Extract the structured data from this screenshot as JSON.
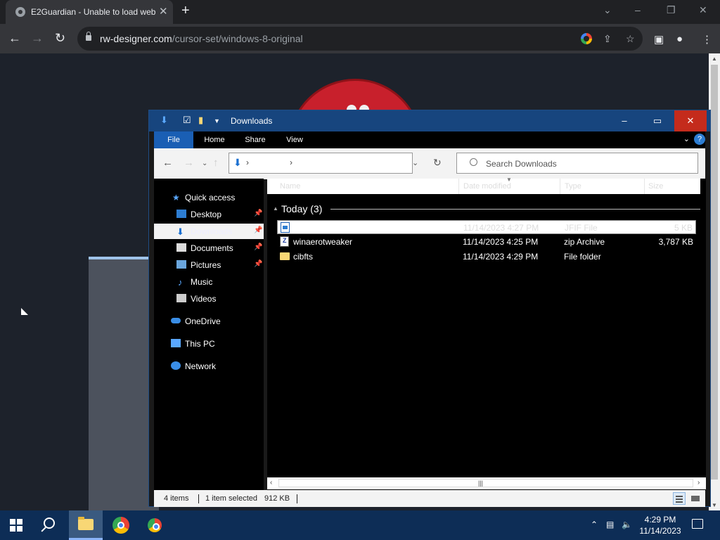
{
  "browser": {
    "tab_title": "E2Guardian - Unable to load web",
    "tab_close": "✕",
    "new_tab": "+",
    "url_host": "rw-designer.com",
    "url_path": "/cursor-set/windows-8-original"
  },
  "explorer": {
    "title": "Downloads",
    "minimize": "–",
    "maximize": "▭",
    "close": "✕",
    "ribbon_tabs": [
      "File",
      "Home",
      "Share",
      "View"
    ],
    "help": "?",
    "address_sep_1": "›",
    "address_sep_2": "›",
    "search_placeholder": "Search Downloads",
    "nav": {
      "quick_access": "Quick access",
      "desktop": "Desktop",
      "downloads": "Downloads",
      "documents": "Documents",
      "pictures": "Pictures",
      "music": "Music",
      "videos": "Videos",
      "onedrive": "OneDrive",
      "this_pc": "This PC",
      "network": "Network"
    },
    "columns": [
      "Name",
      "Date modified",
      "Type",
      "Size"
    ],
    "group": "Today (3)",
    "files": [
      {
        "name": "",
        "date": "11/14/2023 4:27 PM",
        "type": "JFIF File",
        "size": "5 KB"
      },
      {
        "name": "winaerotweaker",
        "date": "11/14/2023 4:25 PM",
        "type": "zip Archive",
        "size": "3,787 KB"
      },
      {
        "name": "cibfts",
        "date": "11/14/2023 4:29 PM",
        "type": "File folder",
        "size": ""
      }
    ],
    "status": {
      "items": "4 items",
      "selected": "1 item selected",
      "selected_size": "912 KB"
    }
  },
  "taskbar": {
    "time": "4:29 PM",
    "date": "11/14/2023"
  }
}
